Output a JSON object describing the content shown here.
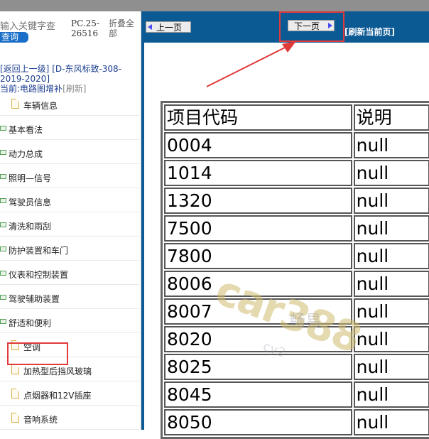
{
  "search": {
    "placeholder": "输入关键字查",
    "button_label": "查询"
  },
  "doc_code": "PC.25-26516",
  "fold_all": "折叠全部",
  "path": {
    "back_link": "[返回上一级]",
    "doc_title": "[D-东风标致-308-2019-2020]",
    "current_prefix": "当前:",
    "current_value": "电路图增补",
    "refresh_label": "[刷新]"
  },
  "tree": {
    "items": [
      {
        "label": "车辆信息",
        "icon": "doc-icon"
      },
      {
        "label": "基本看法",
        "icon": "folder-icon"
      },
      {
        "label": "动力总成",
        "icon": "folder-icon"
      },
      {
        "label": "照明—信号",
        "icon": "folder-icon"
      },
      {
        "label": "驾驶员信息",
        "icon": "folder-icon"
      },
      {
        "label": "清洗和雨刮",
        "icon": "folder-icon"
      },
      {
        "label": "防护装置和车门",
        "icon": "folder-icon"
      },
      {
        "label": "仪表和控制装置",
        "icon": "folder-icon"
      },
      {
        "label": "驾驶辅助装置",
        "icon": "folder-icon"
      },
      {
        "label": "舒适和便利",
        "icon": "folder-icon"
      },
      {
        "label": "空调",
        "icon": "doc-icon"
      },
      {
        "label": "加热型后挡风玻璃",
        "icon": "doc-icon"
      },
      {
        "label": "点烟器和12V插座",
        "icon": "doc-icon"
      },
      {
        "label": "音响系统",
        "icon": "doc-icon"
      }
    ]
  },
  "nav": {
    "prev_label": "上一页",
    "next_label": "下一页",
    "refresh_label": "[刷新当前页]"
  },
  "table": {
    "headers": [
      "项目代码",
      "说明"
    ],
    "rows": [
      [
        "0004",
        "null"
      ],
      [
        "1014",
        "null"
      ],
      [
        "1320",
        "null"
      ],
      [
        "7500",
        "null"
      ],
      [
        "7800",
        "null"
      ],
      [
        "8006",
        "null"
      ],
      [
        "8007",
        "null"
      ],
      [
        "8020",
        "null"
      ],
      [
        "8025",
        "null"
      ],
      [
        "8045",
        "null"
      ],
      [
        "8050",
        "null"
      ]
    ]
  },
  "watermark": {
    "main": "car388",
    "cn": "畅易",
    "url": "cy2"
  },
  "colors": {
    "header_blue": "#0c5a94",
    "highlight_red": "#e03a3a",
    "search_blue": "#1b6fc8"
  }
}
